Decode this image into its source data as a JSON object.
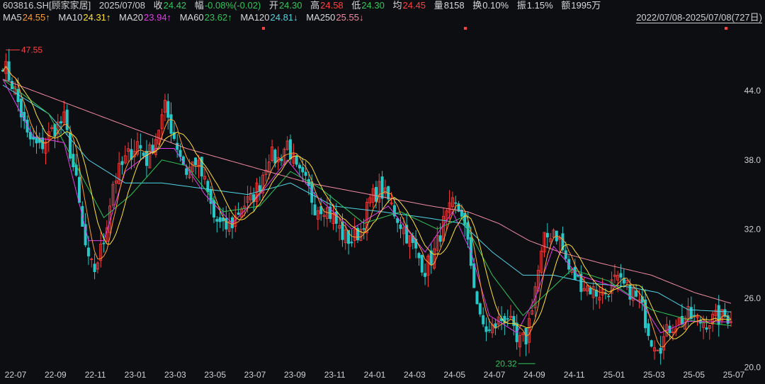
{
  "header": {
    "code": "603816.SH[顾家家居]",
    "date": "2025/07/08",
    "close_label": "收",
    "close": "24.42",
    "change_label": "幅",
    "change": "-0.08%(-0.02)",
    "open_label": "开",
    "open": "24.30",
    "high_label": "高",
    "high": "24.58",
    "low_label": "低",
    "low": "24.30",
    "avg_label": "均",
    "avg": "24.45",
    "volume_label": "量",
    "volume": "8158",
    "turnover_label": "换",
    "turnover": "0.10%",
    "amplitude_label": "振",
    "amplitude": "1.15%",
    "amount_label": "额",
    "amount": "1995万"
  },
  "ma_legend": [
    {
      "label": "MA5",
      "value": "24.55↑",
      "color": "#ff9f2f"
    },
    {
      "label": "MA10",
      "value": "24.31↑",
      "color": "#ffe135"
    },
    {
      "label": "MA20",
      "value": "23.94↑",
      "color": "#e23ce8"
    },
    {
      "label": "MA60",
      "value": "23.62↑",
      "color": "#2fc55a"
    },
    {
      "label": "MA120",
      "value": "24.81↓",
      "color": "#4fd6e6"
    },
    {
      "label": "MA250",
      "value": "25.55↓",
      "color": "#f08aa0"
    }
  ],
  "range_label": "2022/07/08-2025/07/08(727日)",
  "colors": {
    "background": "#0d0e12",
    "up": "#ff3b3b",
    "down": "#28c7c7",
    "axis_text": "#d0d0d0",
    "high_marker": "#ff4040",
    "low_marker": "#2fc55a"
  },
  "chart_data": {
    "type": "candlestick",
    "x_labels": [
      "22-07",
      "22-09",
      "22-11",
      "23-01",
      "23-03",
      "23-05",
      "23-07",
      "23-09",
      "23-11",
      "24-01",
      "24-03",
      "24-05",
      "24-07",
      "24-09",
      "24-11",
      "25-01",
      "25-03",
      "25-05",
      "25-07"
    ],
    "y_ticks": [
      "20.0",
      "26.0",
      "32.0",
      "38.0",
      "44.0"
    ],
    "ylim": [
      19.6,
      48.5
    ],
    "series_close": [
      [
        0,
        46.5
      ],
      [
        4,
        44
      ],
      [
        8,
        40
      ],
      [
        12,
        39
      ],
      [
        16,
        40.5
      ],
      [
        20,
        41.5
      ],
      [
        24,
        36
      ],
      [
        26,
        32
      ],
      [
        28,
        29
      ],
      [
        30,
        28.5
      ],
      [
        33,
        31
      ],
      [
        36,
        36
      ],
      [
        40,
        38
      ],
      [
        44,
        39.5
      ],
      [
        47,
        38
      ],
      [
        50,
        40
      ],
      [
        53,
        42.5
      ],
      [
        56,
        40
      ],
      [
        60,
        37
      ],
      [
        63,
        38
      ],
      [
        66,
        36
      ],
      [
        69,
        33
      ],
      [
        72,
        32
      ],
      [
        75,
        32.5
      ],
      [
        78,
        34
      ],
      [
        81,
        34.5
      ],
      [
        84,
        36
      ],
      [
        87,
        38.5
      ],
      [
        90,
        38
      ],
      [
        93,
        39.5
      ],
      [
        96,
        37
      ],
      [
        99,
        36
      ],
      [
        102,
        34
      ],
      [
        105,
        34
      ],
      [
        108,
        33
      ],
      [
        111,
        31.5
      ],
      [
        114,
        31
      ],
      [
        117,
        32
      ],
      [
        120,
        34.5
      ],
      [
        123,
        35.5
      ],
      [
        126,
        34.5
      ],
      [
        129,
        33
      ],
      [
        132,
        31.5
      ],
      [
        135,
        30
      ],
      [
        138,
        28.5
      ],
      [
        141,
        30
      ],
      [
        144,
        32.5
      ],
      [
        147,
        34
      ],
      [
        150,
        33.5
      ],
      [
        153,
        29
      ],
      [
        156,
        24
      ],
      [
        159,
        23
      ],
      [
        162,
        24
      ],
      [
        165,
        24.5
      ],
      [
        168,
        22
      ],
      [
        171,
        22.5
      ],
      [
        174,
        27
      ],
      [
        177,
        31
      ],
      [
        180,
        32
      ],
      [
        182,
        31
      ],
      [
        185,
        28.5
      ],
      [
        188,
        27.5
      ],
      [
        191,
        27
      ],
      [
        194,
        26.5
      ],
      [
        197,
        26.5
      ],
      [
        200,
        27.5
      ],
      [
        203,
        27
      ],
      [
        206,
        26.5
      ],
      [
        209,
        25
      ],
      [
        212,
        22.5
      ],
      [
        215,
        22
      ],
      [
        218,
        23.5
      ],
      [
        221,
        24
      ],
      [
        224,
        24.5
      ],
      [
        227,
        24
      ],
      [
        230,
        24
      ],
      [
        233,
        24.2
      ],
      [
        236,
        24.4
      ],
      [
        238,
        24.42
      ]
    ],
    "ma_paths": {
      "MA20": [
        [
          0,
          45
        ],
        [
          10,
          40
        ],
        [
          20,
          39.5
        ],
        [
          28,
          31
        ],
        [
          33,
          31
        ],
        [
          40,
          37
        ],
        [
          50,
          39
        ],
        [
          56,
          39
        ],
        [
          66,
          35
        ],
        [
          75,
          32.5
        ],
        [
          84,
          35
        ],
        [
          93,
          38
        ],
        [
          102,
          35
        ],
        [
          114,
          32
        ],
        [
          126,
          34
        ],
        [
          138,
          30
        ],
        [
          147,
          33.5
        ],
        [
          153,
          30
        ],
        [
          159,
          24.5
        ],
        [
          168,
          23
        ],
        [
          174,
          26
        ],
        [
          180,
          30.5
        ],
        [
          188,
          28
        ],
        [
          200,
          27
        ],
        [
          209,
          25.5
        ],
        [
          215,
          23
        ],
        [
          224,
          24
        ],
        [
          238,
          23.94
        ]
      ],
      "MA60": [
        [
          0,
          45
        ],
        [
          15,
          42
        ],
        [
          25,
          37
        ],
        [
          33,
          33
        ],
        [
          42,
          35
        ],
        [
          52,
          38
        ],
        [
          60,
          37.5
        ],
        [
          72,
          33.5
        ],
        [
          84,
          34
        ],
        [
          94,
          37
        ],
        [
          104,
          35.5
        ],
        [
          118,
          32.5
        ],
        [
          130,
          33.5
        ],
        [
          142,
          32
        ],
        [
          150,
          33
        ],
        [
          160,
          28
        ],
        [
          170,
          24.5
        ],
        [
          178,
          26.5
        ],
        [
          186,
          28.5
        ],
        [
          198,
          27.5
        ],
        [
          212,
          25
        ],
        [
          226,
          24
        ],
        [
          238,
          23.62
        ]
      ],
      "MA120": [
        [
          0,
          44.5
        ],
        [
          15,
          42
        ],
        [
          28,
          38
        ],
        [
          40,
          36
        ],
        [
          52,
          36
        ],
        [
          66,
          35.5
        ],
        [
          80,
          35
        ],
        [
          94,
          36
        ],
        [
          108,
          34
        ],
        [
          124,
          33.5
        ],
        [
          138,
          33
        ],
        [
          150,
          32.5
        ],
        [
          160,
          30
        ],
        [
          170,
          28
        ],
        [
          180,
          28
        ],
        [
          192,
          27.3
        ],
        [
          204,
          27
        ],
        [
          214,
          26.5
        ],
        [
          224,
          25
        ],
        [
          238,
          24.81
        ]
      ],
      "MA250": [
        [
          0,
          45
        ],
        [
          20,
          43
        ],
        [
          40,
          41
        ],
        [
          60,
          39
        ],
        [
          80,
          37.5
        ],
        [
          100,
          36
        ],
        [
          120,
          35
        ],
        [
          140,
          34
        ],
        [
          152,
          33.5
        ],
        [
          162,
          32.5
        ],
        [
          172,
          31
        ],
        [
          182,
          30
        ],
        [
          196,
          29
        ],
        [
          212,
          28
        ],
        [
          226,
          26.5
        ],
        [
          238,
          25.55
        ]
      ]
    },
    "max_label": "47.55",
    "min_label": "20.32"
  }
}
